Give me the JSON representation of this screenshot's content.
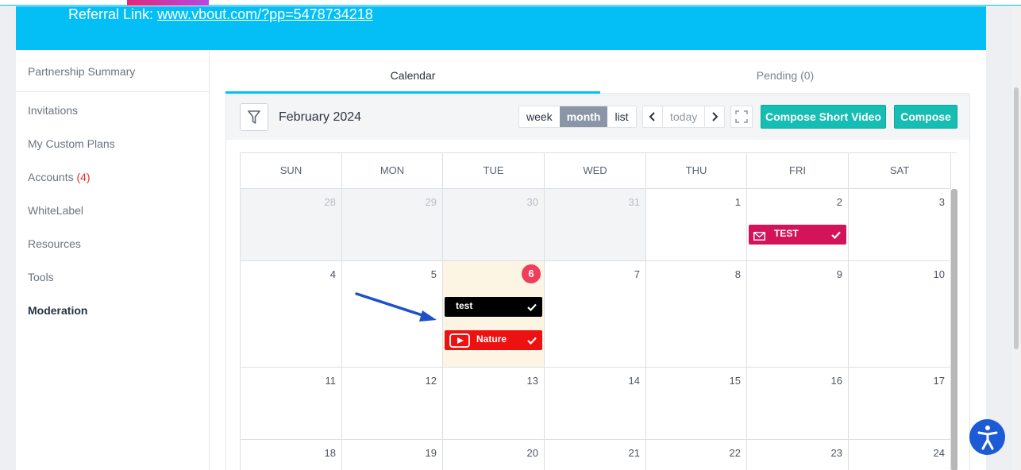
{
  "banner": {
    "referral_label": "Referral Link:",
    "referral_url": "www.vbout.com/?pp=5478734218"
  },
  "sidebar": {
    "items": [
      {
        "label": "Partnership Summary"
      },
      {
        "label": "Invitations"
      },
      {
        "label": "My Custom Plans"
      },
      {
        "label": "Accounts",
        "count": "(4)"
      },
      {
        "label": "WhiteLabel"
      },
      {
        "label": "Resources"
      },
      {
        "label": "Tools"
      },
      {
        "label": "Moderation",
        "active": true
      }
    ]
  },
  "tabs": [
    {
      "label": "Calendar",
      "active": true
    },
    {
      "label": "Pending (0)"
    }
  ],
  "toolbar": {
    "month_title": "February 2024",
    "views": [
      "week",
      "month",
      "list"
    ],
    "active_view": "month",
    "today_label": "today",
    "compose_short_video": "Compose Short Video",
    "compose": "Compose"
  },
  "calendar": {
    "weekdays": [
      "SUN",
      "MON",
      "TUE",
      "WED",
      "THU",
      "FRI",
      "SAT"
    ],
    "weeks": [
      [
        "28",
        "29",
        "30",
        "31",
        "1",
        "2",
        "3"
      ],
      [
        "4",
        "5",
        "6",
        "7",
        "8",
        "9",
        "10"
      ],
      [
        "11",
        "12",
        "13",
        "14",
        "15",
        "16",
        "17"
      ],
      [
        "18",
        "19",
        "20",
        "21",
        "22",
        "23",
        "24"
      ]
    ],
    "today": "6",
    "events": [
      {
        "title": "TEST",
        "date": "2",
        "kind": "email",
        "color": "#d4145a"
      },
      {
        "title": "test",
        "date": "6",
        "kind": "text",
        "color": "#000000"
      },
      {
        "title": "Nature",
        "date": "6",
        "kind": "youtube",
        "color": "#ee1111"
      }
    ]
  },
  "colors": {
    "brand": "#04bff5",
    "teal_button": "#15bdb2",
    "today_badge": "#ef3e5b",
    "annotation_arrow": "#1f4fc9"
  }
}
